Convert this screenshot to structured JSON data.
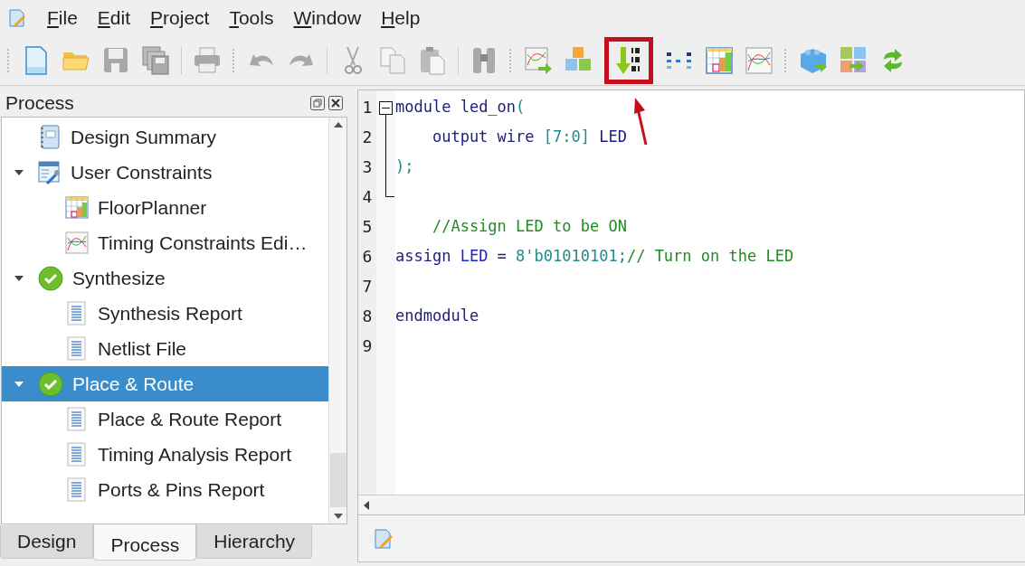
{
  "menu": [
    "File",
    "Edit",
    "Project",
    "Tools",
    "Window",
    "Help"
  ],
  "toolbar": [
    {
      "kind": "grip"
    },
    {
      "kind": "new",
      "highlighted": false
    },
    {
      "kind": "open",
      "highlighted": false
    },
    {
      "kind": "save",
      "highlighted": false
    },
    {
      "kind": "saveall",
      "highlighted": false
    },
    {
      "kind": "sep"
    },
    {
      "kind": "print",
      "highlighted": false
    },
    {
      "kind": "grip"
    },
    {
      "kind": "undo",
      "highlighted": false
    },
    {
      "kind": "redo",
      "highlighted": false
    },
    {
      "kind": "sep"
    },
    {
      "kind": "cut",
      "highlighted": false
    },
    {
      "kind": "copy",
      "highlighted": false
    },
    {
      "kind": "paste",
      "highlighted": false
    },
    {
      "kind": "sep"
    },
    {
      "kind": "find",
      "highlighted": false
    },
    {
      "kind": "grip"
    },
    {
      "kind": "chartarrow",
      "highlighted": false
    },
    {
      "kind": "cubes",
      "highlighted": false
    },
    {
      "kind": "program",
      "highlighted": true
    },
    {
      "kind": "dots",
      "highlighted": false
    },
    {
      "kind": "floorplan",
      "highlighted": false
    },
    {
      "kind": "timing",
      "highlighted": false
    },
    {
      "kind": "grip"
    },
    {
      "kind": "brick",
      "highlighted": false
    },
    {
      "kind": "tiles",
      "highlighted": false
    },
    {
      "kind": "refresh",
      "highlighted": false
    }
  ],
  "panel": {
    "title": "Process",
    "tree": [
      {
        "label": "Design Summary",
        "kind": "summary",
        "selected": false
      },
      {
        "label": "User Constraints",
        "kind": "constraints",
        "selected": false,
        "expanded": true,
        "children": [
          {
            "label": "FloorPlanner",
            "kind": "floorplan",
            "selected": false
          },
          {
            "label": "Timing Constraints Edi…",
            "kind": "timing",
            "selected": false
          }
        ]
      },
      {
        "label": "Synthesize",
        "kind": "done",
        "selected": false,
        "expanded": true,
        "children": [
          {
            "label": "Synthesis Report",
            "kind": "report",
            "selected": false
          },
          {
            "label": "Netlist File",
            "kind": "report",
            "selected": false
          }
        ]
      },
      {
        "label": "Place & Route",
        "kind": "done",
        "selected": true,
        "expanded": true,
        "children": [
          {
            "label": "Place & Route Report",
            "kind": "report",
            "selected": false
          },
          {
            "label": "Timing Analysis Report",
            "kind": "report",
            "selected": false
          },
          {
            "label": "Ports & Pins Report",
            "kind": "report",
            "selected": false
          }
        ]
      }
    ],
    "tabs": [
      {
        "label": "Design",
        "selected": false
      },
      {
        "label": "Process",
        "selected": true
      },
      {
        "label": "Hierarchy",
        "selected": false
      }
    ]
  },
  "editor": {
    "lines": [
      {
        "number": "1",
        "tokens": [
          {
            "kind": "keyword",
            "text": "module"
          },
          {
            "kind": "plain",
            "text": " led_on"
          },
          {
            "kind": "punct",
            "text": "("
          }
        ]
      },
      {
        "number": "2",
        "tokens": [
          {
            "kind": "keyword",
            "text": "    output wire "
          },
          {
            "kind": "punct",
            "text": "[7:0]"
          },
          {
            "kind": "keyword",
            "text": " LED"
          }
        ]
      },
      {
        "number": "3",
        "tokens": [
          {
            "kind": "punct",
            "text": ");"
          }
        ]
      },
      {
        "number": "4"
      },
      {
        "number": "5",
        "tokens": [
          {
            "kind": "comment",
            "text": "    //Assign LED to be ON"
          }
        ]
      },
      {
        "number": "6",
        "tokens": [
          {
            "kind": "keyword",
            "text": "assign "
          },
          {
            "kind": "ident",
            "text": "LED"
          },
          {
            "kind": "keyword",
            "text": " = "
          },
          {
            "kind": "punct",
            "text": "8'b01010101;"
          },
          {
            "kind": "comment",
            "text": "// Turn on the LED"
          }
        ]
      },
      {
        "number": "7"
      },
      {
        "number": "8",
        "tokens": [
          {
            "kind": "keyword",
            "text": "endmodule"
          }
        ]
      },
      {
        "number": "9"
      }
    ]
  }
}
